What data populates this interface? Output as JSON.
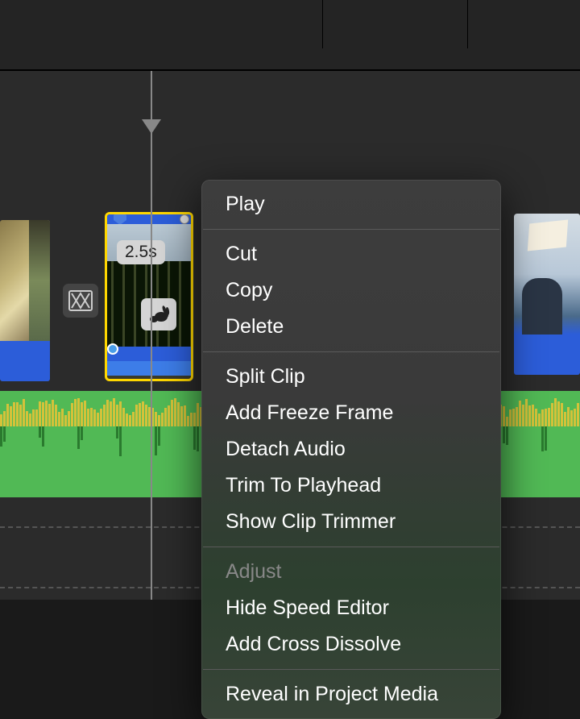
{
  "clip": {
    "duration_badge": "2.5s",
    "speed_icon": "rabbit-icon"
  },
  "context_menu": {
    "groups": [
      [
        "Play"
      ],
      [
        "Cut",
        "Copy",
        "Delete"
      ],
      [
        "Split Clip",
        "Add Freeze Frame",
        "Detach Audio",
        "Trim To Playhead",
        "Show Clip Trimmer"
      ],
      [
        {
          "label": "Adjust",
          "disabled": true
        },
        "Hide Speed Editor",
        "Add Cross Dissolve"
      ],
      [
        "Reveal in Project Media"
      ]
    ]
  }
}
